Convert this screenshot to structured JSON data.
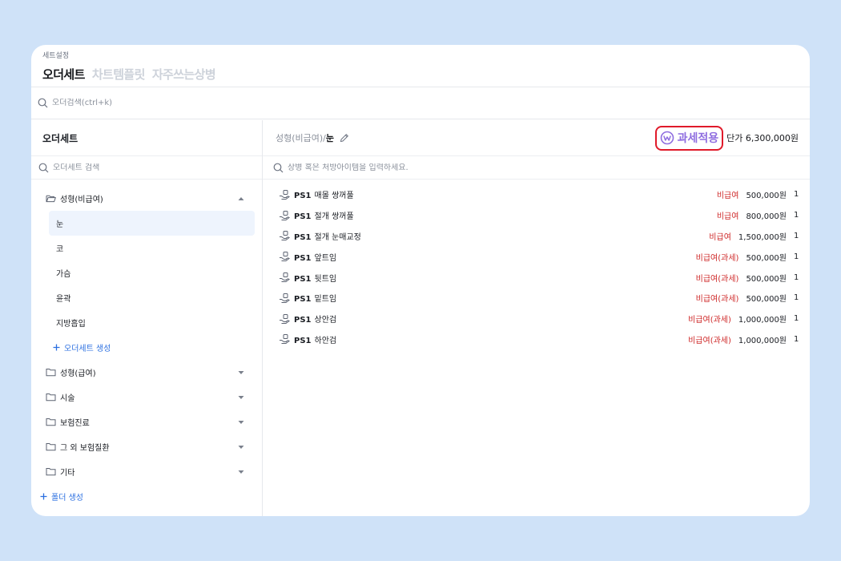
{
  "header": {
    "breadcrumb": "세트설정",
    "tabs": [
      {
        "label": "오더세트"
      },
      {
        "label": "차트템플릿"
      },
      {
        "label": "자주쓰는상병"
      }
    ]
  },
  "global_search": {
    "placeholder": "오더검색(ctrl+k)"
  },
  "left": {
    "title": "오더세트",
    "search_placeholder": "오더세트 검색",
    "open_folder": {
      "label": "성형(비급여)",
      "children": [
        "눈",
        "코",
        "가슴",
        "윤곽",
        "지방흡입"
      ],
      "add_label": "오더세트 생성"
    },
    "folders": [
      "성형(급여)",
      "시술",
      "보험진료",
      "그 외 보험질환",
      "기타"
    ],
    "add_folder_label": "폴더 생성"
  },
  "right": {
    "path_prefix": "성형(비급여)/",
    "path_current": "눈",
    "tax_label": "과세적용",
    "price_label": "단가 6,300,000원",
    "search_placeholder": "상병 혹은 처방아이템을 입력하세요.",
    "items": [
      {
        "code": "PS1",
        "name": "매몰 쌍꺼풀",
        "type": "비급여",
        "amount": "500,000원",
        "qty": "1"
      },
      {
        "code": "PS1",
        "name": "절개 쌍꺼풀",
        "type": "비급여",
        "amount": "800,000원",
        "qty": "1"
      },
      {
        "code": "PS1",
        "name": "절개 눈매교정",
        "type": "비급여",
        "amount": "1,500,000원",
        "qty": "1"
      },
      {
        "code": "PS1",
        "name": "앞트임",
        "type": "비급여(과세)",
        "amount": "500,000원",
        "qty": "1"
      },
      {
        "code": "PS1",
        "name": "뒷트임",
        "type": "비급여(과세)",
        "amount": "500,000원",
        "qty": "1"
      },
      {
        "code": "PS1",
        "name": "밑트임",
        "type": "비급여(과세)",
        "amount": "500,000원",
        "qty": "1"
      },
      {
        "code": "PS1",
        "name": "상안검",
        "type": "비급여(과세)",
        "amount": "1,000,000원",
        "qty": "1"
      },
      {
        "code": "PS1",
        "name": "하안검",
        "type": "비급여(과세)",
        "amount": "1,000,000원",
        "qty": "1"
      }
    ]
  },
  "colors": {
    "accent": "#2b6fe0",
    "tax": "#8f6ee0",
    "highlight": "#e01a2a",
    "nonpay": "#cf2a2a",
    "background": "#cfe2f8"
  }
}
